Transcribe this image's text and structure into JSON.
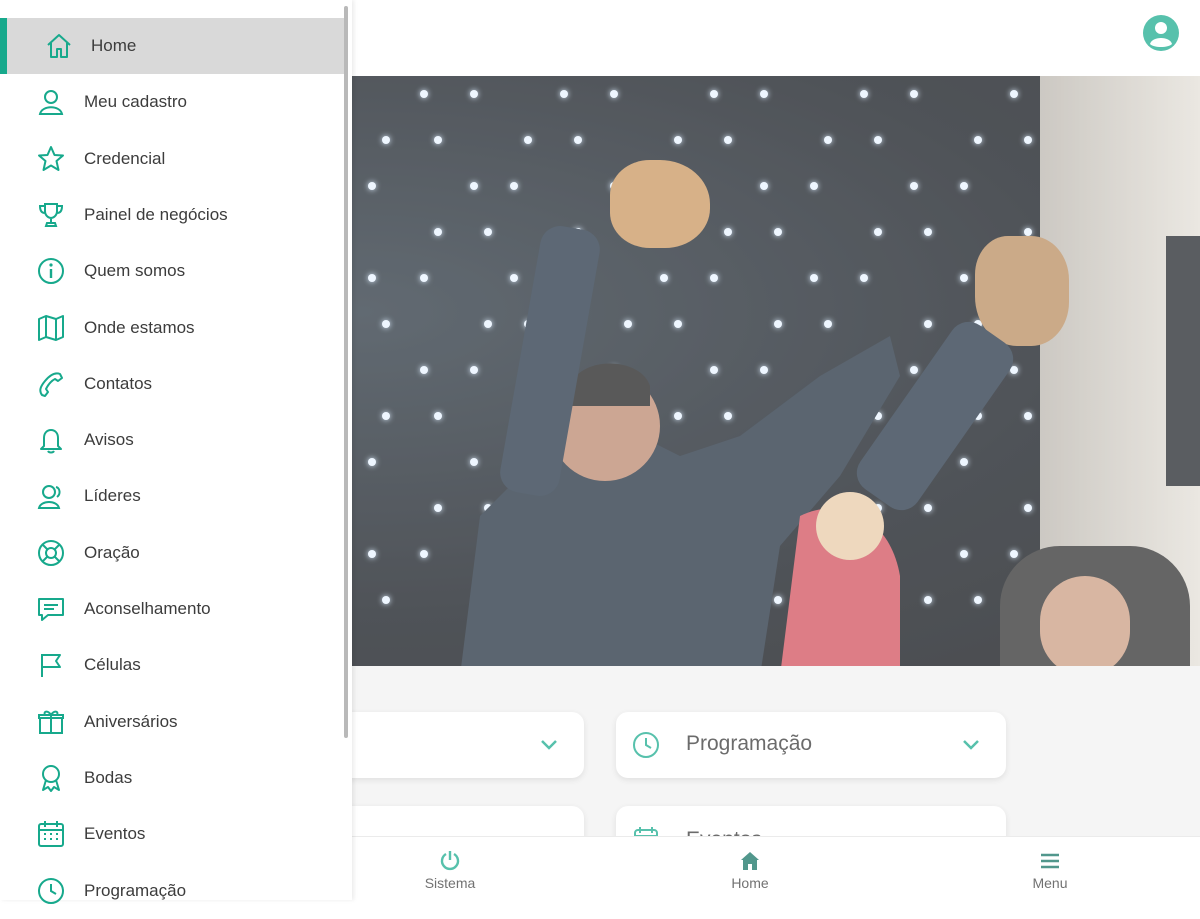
{
  "accent": "#17a98c",
  "header": {
    "profile_icon": "user-circle-icon"
  },
  "cards": [
    {
      "label": "",
      "icon": "blank"
    },
    {
      "label": "Programação",
      "icon": "clock-icon"
    },
    {
      "label": "",
      "icon": "blank"
    },
    {
      "label": "Eventos",
      "icon": "calendar-icon"
    }
  ],
  "bottom_nav": [
    {
      "label": "Sistema",
      "icon": "power-icon"
    },
    {
      "label": "Home",
      "icon": "home-icon"
    },
    {
      "label": "Menu",
      "icon": "hamburger-icon"
    }
  ],
  "drawer": {
    "items": [
      {
        "label": "Home",
        "icon": "home-icon",
        "active": true
      },
      {
        "label": "Meu cadastro",
        "icon": "user-icon"
      },
      {
        "label": "Credencial",
        "icon": "star-icon"
      },
      {
        "label": "Painel de negócios",
        "icon": "trophy-icon"
      },
      {
        "label": "Quem somos",
        "icon": "info-icon"
      },
      {
        "label": "Onde estamos",
        "icon": "map-icon"
      },
      {
        "label": "Contatos",
        "icon": "phone-icon"
      },
      {
        "label": "Avisos",
        "icon": "bell-icon"
      },
      {
        "label": "Líderes",
        "icon": "leader-icon"
      },
      {
        "label": "Oração",
        "icon": "lifebuoy-icon"
      },
      {
        "label": "Aconselhamento",
        "icon": "chat-icon"
      },
      {
        "label": "Células",
        "icon": "flag-icon"
      },
      {
        "label": "Aniversários",
        "icon": "gift-icon"
      },
      {
        "label": "Bodas",
        "icon": "award-icon"
      },
      {
        "label": "Eventos",
        "icon": "calendar-icon"
      },
      {
        "label": "Programação",
        "icon": "clock-icon"
      }
    ]
  }
}
